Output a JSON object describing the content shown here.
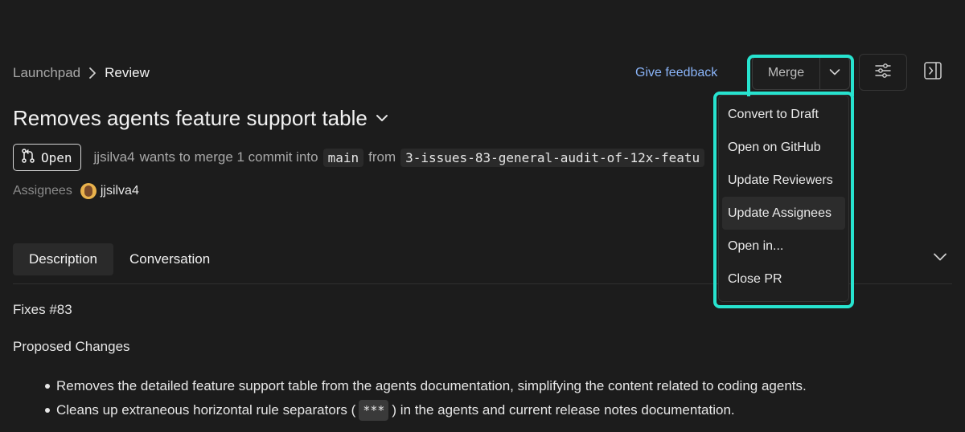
{
  "breadcrumb": {
    "parent": "Launchpad",
    "current": "Review"
  },
  "header": {
    "feedback_label": "Give feedback",
    "merge_label": "Merge"
  },
  "pr": {
    "title": "Removes agents feature support table",
    "status": "Open",
    "author": "jjsilva4",
    "merge_text": "wants to merge 1 commit into",
    "base_branch": "main",
    "from_text": "from",
    "head_branch": "3-issues-83-general-audit-of-12x-featu"
  },
  "assignees": {
    "label": "Assignees",
    "names": [
      "jjsilva4"
    ]
  },
  "tabs": [
    {
      "label": "Description",
      "active": true
    },
    {
      "label": "Conversation",
      "active": false
    }
  ],
  "description": {
    "fixes": "Fixes #83",
    "heading": "Proposed Changes",
    "items": [
      {
        "text": "Removes the detailed feature support table from the agents documentation, simplifying the content related to coding agents."
      },
      {
        "before": "Cleans up extraneous horizontal rule separators (",
        "code": "***",
        "after": ") in the agents and current release notes documentation."
      }
    ]
  },
  "merge_menu": {
    "items": [
      {
        "label": "Convert to Draft"
      },
      {
        "label": "Open on GitHub"
      },
      {
        "label": "Update Reviewers"
      },
      {
        "label": "Update Assignees",
        "hovered": true
      },
      {
        "label": "Open in..."
      },
      {
        "label": "Close PR"
      }
    ]
  },
  "colors": {
    "background": "#1c1c1c",
    "accent_link": "#8ab4f8",
    "highlight": "#27e3cf"
  },
  "icons": [
    "chevron-right-icon",
    "chevron-down-icon",
    "settings-sliders-icon",
    "panel-toggle-icon",
    "pull-request-icon"
  ]
}
